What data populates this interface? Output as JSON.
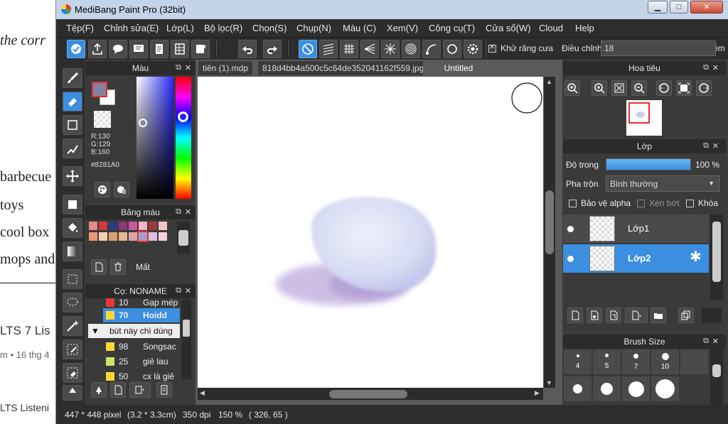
{
  "background_page": {
    "lines": [
      "the corr",
      "barbecue",
      "toys",
      "cool box",
      "mops and"
    ],
    "heading": "LTS 7 Lis",
    "meta": "m • 16 thg 4",
    "footer": "LTS Listeni"
  },
  "window": {
    "title": "MediBang Paint Pro (32bit)",
    "controls": {
      "minimize": "▁",
      "maximize": "□",
      "close": "✕"
    }
  },
  "menu": [
    "Tệp(F)",
    "Chỉnh sửa(E)",
    "Lớp(L)",
    "Bộ lọc(R)",
    "Chọn(S)",
    "Chụp(N)",
    "Màu (C)",
    "Xem(V)",
    "Công cụ(T)",
    "Cửa sổ(W)",
    "Cloud",
    "Help"
  ],
  "toolbar": {
    "antialias_label": "Khử răng cưa",
    "antialias_checked": true,
    "adjust_label": "Điều chỉnh",
    "adjust_value": "18",
    "smooth_label": "Cạnh mềm",
    "smooth_checked": false
  },
  "color_panel": {
    "title": "Màu",
    "r": "R:130",
    "g": "G:129",
    "b": "B:160",
    "hex": "#8281A0",
    "fg_color": "#8281A0",
    "bg_color": "#FFFFFF"
  },
  "palette_panel": {
    "title": "Bảng màu",
    "swatches": [
      "#e8898a",
      "#d43a3a",
      "#2c3e80",
      "#8a3a6e",
      "#c85a9a",
      "#f3b4c8",
      "#a03a3a",
      "#f2c4c4",
      "#e89a7a",
      "#f5d0b0",
      "#d8a070",
      "#e8b890",
      "#d8a8a8",
      "#a0a0d0",
      "#e0c0e0",
      "#f8d0d8"
    ],
    "lost_label": "Mất"
  },
  "brush_panel": {
    "title": "Cọ: NONAME",
    "items": [
      {
        "num": "10",
        "label": "Gạp mép",
        "color": "#e53935",
        "selected": false
      },
      {
        "num": "70",
        "label": "Hoidd",
        "color": "#fdd835",
        "selected": true
      }
    ],
    "group_label": "bút này chì dùng",
    "group_items": [
      {
        "num": "98",
        "label": "Songsac",
        "color": "#fdd835"
      },
      {
        "num": "25",
        "label": "giẻ lau",
        "color": "#c6e86a"
      },
      {
        "num": "50",
        "label": "cx là giẻ",
        "color": "#fdd835"
      }
    ]
  },
  "canvas": {
    "tabs": [
      "tiên (1).mdp",
      "818d4bb4a500c5c64de352041162f559.jpg",
      "Untitled"
    ],
    "active_tab": 2
  },
  "navigator": {
    "title": "Hoa tiêu"
  },
  "layer_panel": {
    "title": "Lớp",
    "opacity_label": "Độ trong",
    "opacity_value": "100 %",
    "opacity_percent": 100,
    "blend_label": "Pha trộn",
    "blend_value": "Bình thường",
    "protect_alpha": "Bảo vệ alpha",
    "clipping": "Xén bớt",
    "lock": "Khóa",
    "layers": [
      {
        "name": "Lớp1",
        "selected": false
      },
      {
        "name": "Lớp2",
        "selected": true
      }
    ]
  },
  "brush_size": {
    "title": "Brush Size",
    "sizes": [
      "4",
      "5",
      "7",
      "10"
    ]
  },
  "status": {
    "dims": "447 * 448 pixel",
    "cm": "(3.2 * 3.3cm)",
    "dpi": "350 dpi",
    "zoom": "150 %",
    "coords": "( 326, 65 )"
  }
}
